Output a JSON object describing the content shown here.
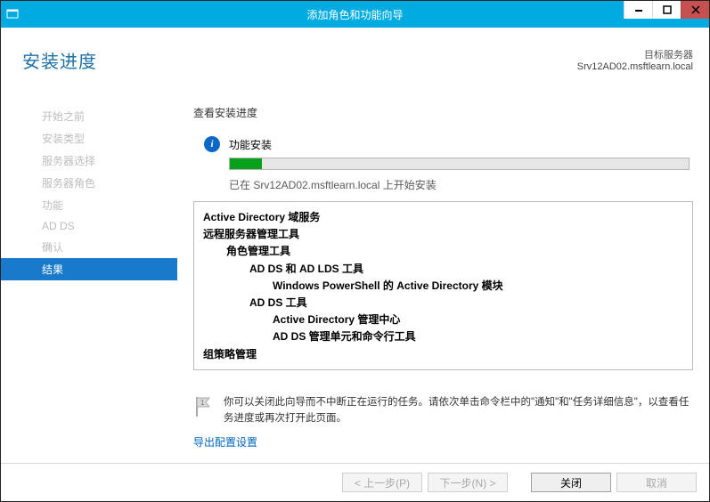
{
  "window": {
    "title": "添加角色和功能向导"
  },
  "header": {
    "page_title": "安装进度",
    "target_label": "目标服务器",
    "target_value": "Srv12AD02.msftlearn.local"
  },
  "nav": {
    "items": [
      "开始之前",
      "安装类型",
      "服务器选择",
      "服务器角色",
      "功能",
      "AD DS",
      "确认",
      "结果"
    ],
    "active_index": 7
  },
  "main": {
    "section_label": "查看安装进度",
    "status": "功能安装",
    "progress_percent": 7,
    "substatus": "已在 Srv12AD02.msftlearn.local 上开始安装",
    "details": [
      {
        "indent": 0,
        "text": "Active Directory 域服务"
      },
      {
        "indent": 0,
        "text": "远程服务器管理工具"
      },
      {
        "indent": 1,
        "text": "角色管理工具"
      },
      {
        "indent": 2,
        "text": "AD DS 和 AD LDS 工具"
      },
      {
        "indent": 3,
        "text": "Windows PowerShell 的 Active Directory 模块"
      },
      {
        "indent": 2,
        "text": "AD DS 工具"
      },
      {
        "indent": 3,
        "text": "Active Directory 管理中心"
      },
      {
        "indent": 3,
        "text": "AD DS 管理单元和命令行工具"
      },
      {
        "indent": 0,
        "text": "组策略管理"
      }
    ],
    "note": "你可以关闭此向导而不中断正在运行的任务。请依次单击命令栏中的\"通知\"和\"任务详细信息\"，以查看任务进度或再次打开此页面。",
    "export_link": "导出配置设置"
  },
  "footer": {
    "previous": "< 上一步(P)",
    "next": "下一步(N) >",
    "close": "关闭",
    "cancel": "取消"
  }
}
